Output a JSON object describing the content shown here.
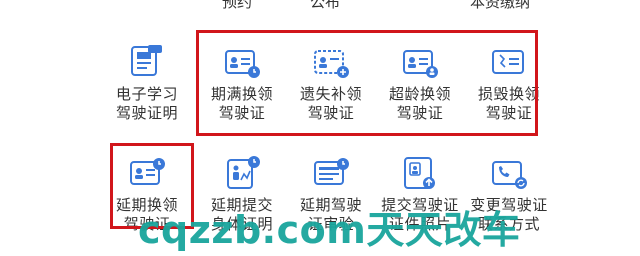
{
  "top_labels": [
    "预约",
    "公布",
    "本资缴纳"
  ],
  "row1": [
    {
      "label": "电子学习\n驾驶证明",
      "icon": "phone-card-icon"
    },
    {
      "label": "期满换领\n驾驶证",
      "icon": "license-clock-icon"
    },
    {
      "label": "遗失补领\n驾驶证",
      "icon": "license-plus-icon"
    },
    {
      "label": "超龄换领\n驾驶证",
      "icon": "license-person-icon"
    },
    {
      "label": "损毁换领\n驾驶证",
      "icon": "license-damaged-icon"
    }
  ],
  "row2": [
    {
      "label": "延期换领\n驾驶证",
      "icon": "license-clock-icon"
    },
    {
      "label": "延期提交\n身体证明",
      "icon": "health-chart-icon"
    },
    {
      "label": "延期驾驶\n证审验",
      "icon": "license-clock-icon"
    },
    {
      "label": "提交驾驶证\n证件照片",
      "icon": "photo-upload-icon"
    },
    {
      "label": "变更驾驶证\n联系方式",
      "icon": "contact-phone-icon"
    }
  ],
  "watermark": "cqzzb.com天天改车",
  "colors": {
    "highlight": "#d1161b",
    "icon_blue": "#3a78d8",
    "watermark": "#19a59c"
  }
}
